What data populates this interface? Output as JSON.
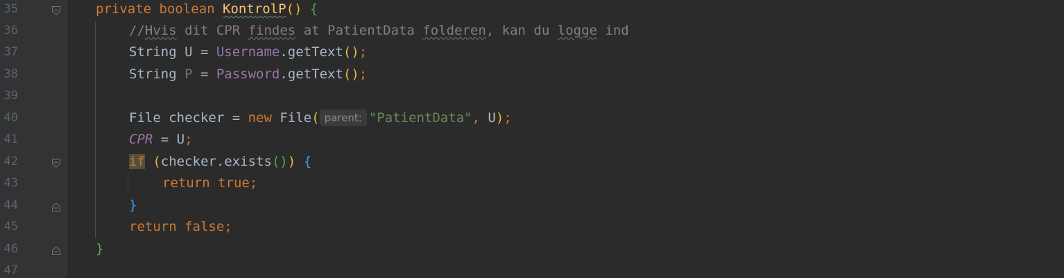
{
  "editor": {
    "lines": [
      {
        "num": "35",
        "tokens": {
          "t1": "private boolean ",
          "t2": "KontrolP",
          "t3": "()",
          "t4": " ",
          "t5": "{"
        }
      },
      {
        "num": "36",
        "tokens": {
          "t1": "//",
          "t2": "Hvis",
          "t3": " dit CPR ",
          "t4": "findes",
          "t5": " at PatientData ",
          "t6": "folderen",
          "t7": ", kan du ",
          "t8": "logge",
          "t9": " ind"
        }
      },
      {
        "num": "37",
        "tokens": {
          "t1": "String U = ",
          "t2": "Username",
          "t3": ".getText",
          "t4": "()",
          "t5": ";"
        }
      },
      {
        "num": "38",
        "tokens": {
          "t1": "String ",
          "t2": "P",
          "t3": " = ",
          "t4": "Password",
          "t5": ".getText",
          "t6": "()",
          "t7": ";"
        }
      },
      {
        "num": "39",
        "tokens": {}
      },
      {
        "num": "40",
        "tokens": {
          "t1": "File checker = ",
          "t2": "new ",
          "t3": "File",
          "t4": "(",
          "hint": "parent:",
          "t5": "\"PatientData\"",
          "t6": ", ",
          "t7": "U",
          "t8": ")",
          "t9": ";"
        }
      },
      {
        "num": "41",
        "tokens": {
          "t1": "CPR",
          "t2": " = U",
          "t3": ";"
        }
      },
      {
        "num": "42",
        "tokens": {
          "t1": "if",
          "t2": " ",
          "t3": "(",
          "t4": "checker.exists",
          "t5": "()",
          "t6": ")",
          "t7": " ",
          "t8": "{"
        }
      },
      {
        "num": "43",
        "tokens": {
          "t1": "return true",
          "t2": ";"
        }
      },
      {
        "num": "44",
        "tokens": {
          "t1": "}"
        }
      },
      {
        "num": "45",
        "tokens": {
          "t1": "return false",
          "t2": ";"
        }
      },
      {
        "num": "46",
        "tokens": {
          "t1": "}"
        }
      },
      {
        "num": "47",
        "tokens": {}
      }
    ]
  },
  "icons": {
    "fold_open": "fold-open-icon",
    "fold_end": "fold-end-icon"
  },
  "colors": {
    "background": "#2b2b2b",
    "gutter": "#313335",
    "keyword": "#cc7832",
    "method": "#ffc66d",
    "field": "#9876aa",
    "string": "#6a8759",
    "comment": "#808080"
  }
}
